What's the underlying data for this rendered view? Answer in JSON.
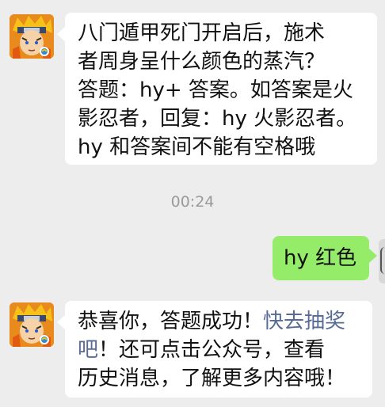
{
  "chat": {
    "messages": [
      {
        "sender": "other",
        "avatar_icon": "naruto-game-avatar-icon",
        "lines": [
          "八门遁甲死门开启后，施术",
          "者周身呈什么颜色的蒸汽？",
          "答题：hy+ 答案。如答案是火",
          "影忍者，回复：hy 火影忍者。",
          "hy 和答案间不能有空格哦"
        ]
      },
      {
        "sender": "self",
        "text": "hy 红色"
      },
      {
        "sender": "other",
        "avatar_icon": "naruto-game-avatar-icon",
        "line1_text": "恭喜你，答题成功！",
        "line1_link": "快去抽奖",
        "line2_link": "吧",
        "line2_text": "！还可点击公众号，查看",
        "line3_text": "历史消息，了解更多内容哦！"
      }
    ],
    "timestamp": "00:24"
  },
  "colors": {
    "background": "#ededed",
    "incoming_bubble": "#ffffff",
    "outgoing_bubble": "#95ec69",
    "link": "#576b95",
    "timestamp": "#9a9a9a"
  }
}
